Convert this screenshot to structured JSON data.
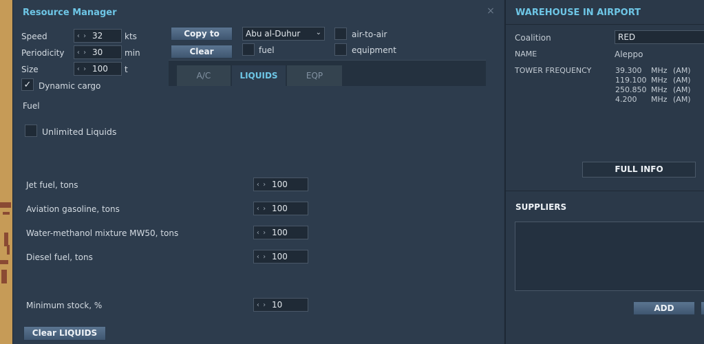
{
  "resource_manager": {
    "title": "Resource Manager",
    "speed": {
      "label": "Speed",
      "value": "32",
      "unit": "kts"
    },
    "periodicity": {
      "label": "Periodicity",
      "value": "30",
      "unit": "min"
    },
    "size": {
      "label": "Size",
      "value": "100",
      "unit": "t"
    },
    "dynamic_cargo": {
      "label": "Dynamic cargo",
      "checked": true
    },
    "copy_to_button": "Copy to",
    "clear_button": "Clear",
    "airport_select": "Abu al-Duhur",
    "filters": {
      "air_to_air": "air-to-air",
      "fuel": "fuel",
      "equipment": "equipment"
    },
    "tabs": [
      "A/C",
      "LIQUIDS",
      "EQP"
    ],
    "active_tab": "LIQUIDS",
    "section_label": "Fuel",
    "unlimited_liquids": "Unlimited Liquids",
    "liquids": [
      {
        "label": "Jet fuel, tons",
        "value": "100"
      },
      {
        "label": "Aviation gasoline, tons",
        "value": "100"
      },
      {
        "label": "Water-methanol mixture MW50, tons",
        "value": "100"
      },
      {
        "label": "Diesel fuel, tons",
        "value": "100"
      }
    ],
    "minimum_stock": {
      "label": "Minimum stock, %",
      "value": "10"
    },
    "clear_liquids_button": "Clear LIQUIDS"
  },
  "warehouse": {
    "title": "WAREHOUSE IN AIRPORT",
    "coalition_label": "Coalition",
    "coalition_value": "RED",
    "name_label": "NAME",
    "name_value": "Aleppo",
    "tower_label": "TOWER FREQUENCY",
    "frequencies": [
      {
        "freq": "39.300",
        "unit": "MHz",
        "mod": "(AM)"
      },
      {
        "freq": "119.100",
        "unit": "MHz",
        "mod": "(AM)"
      },
      {
        "freq": "250.850",
        "unit": "MHz",
        "mod": "(AM)"
      },
      {
        "freq": "4.200",
        "unit": "MHz",
        "mod": "(AM)"
      }
    ],
    "full_info_button": "FULL INFO",
    "suppliers_label": "SUPPLIERS",
    "add_button": "ADD"
  }
}
